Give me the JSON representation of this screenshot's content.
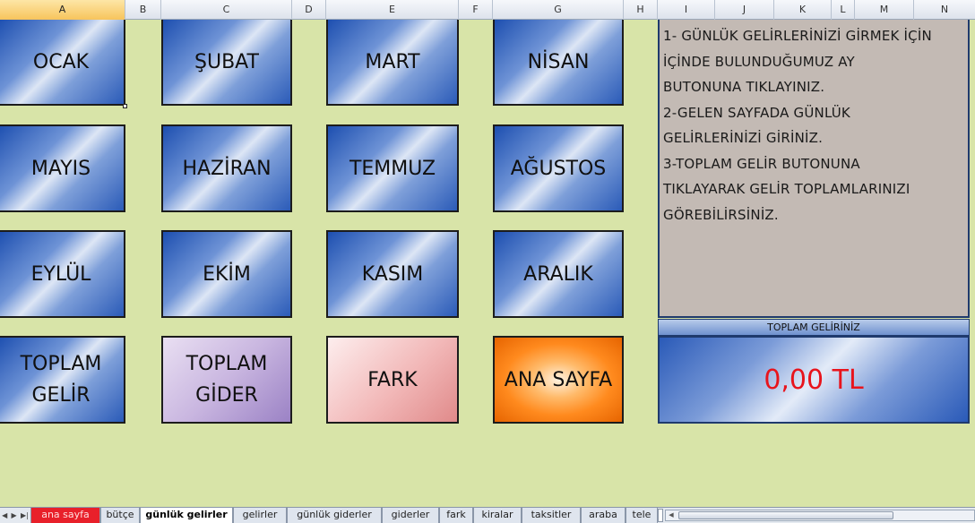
{
  "columns": [
    "A",
    "B",
    "C",
    "D",
    "E",
    "F",
    "G",
    "H",
    "I",
    "J",
    "K",
    "L",
    "M",
    "N"
  ],
  "month_buttons": {
    "ocak": "OCAK",
    "subat": "ŞUBAT",
    "mart": "MART",
    "nisan": "NİSAN",
    "mayis": "MAYIS",
    "haziran": "HAZİRAN",
    "temmuz": "TEMMUZ",
    "agustos": "AĞUSTOS",
    "eylul": "EYLÜL",
    "ekim": "EKİM",
    "kasim": "KASIM",
    "aralik": "ARALIK"
  },
  "action_buttons": {
    "toplam_gelir_1": "TOPLAM",
    "toplam_gelir_2": "GELİR",
    "toplam_gider_1": "TOPLAM",
    "toplam_gider_2": "GİDER",
    "fark": "FARK",
    "ana_sayfa": "ANA SAYFA"
  },
  "instructions": [
    "1- GÜNLÜK GELİRLERİNİZİ GİRMEK İÇİN",
    "İÇİNDE BULUNDUĞUMUZ AY",
    "BUTONUNA TIKLAYINIZ.",
    "2-GELEN SAYFADA GÜNLÜK",
    "GELİRLERİNİZİ GİRİNİZ.",
    "3-TOPLAM GELİR BUTONUNA",
    "TIKLAYARAK GELİR TOPLAMLARINIZI",
    "GÖREBİLİRSİNİZ."
  ],
  "total": {
    "label": "TOPLAM GELİRİNİZ",
    "value": "0,00 TL"
  },
  "tabs": [
    "ana sayfa",
    "bütçe",
    "günlük gelirler",
    "gelirler",
    "günlük giderler",
    "giderler",
    "fark",
    "kiralar",
    "taksitler",
    "araba",
    "tele"
  ],
  "active_tab": "günlük gelirler",
  "colors": {
    "sheet_background": "#d8e4a8",
    "value_text": "#e8141c",
    "red_tab": "#e8202a"
  }
}
